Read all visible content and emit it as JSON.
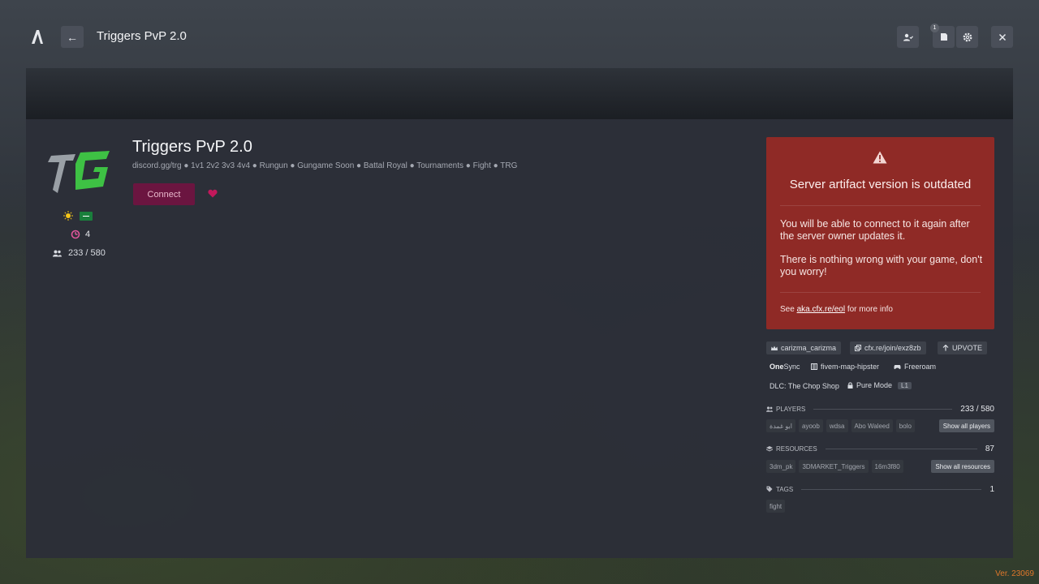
{
  "header": {
    "title": "Triggers PvP 2.0",
    "back_icon": "←",
    "notif_count": "1"
  },
  "server": {
    "name": "Triggers PvP 2.0",
    "description": "discord.gg/trg ● 1v1 2v2 3v3 4v4 ● Rungun ● Gungame Soon ● Battal Royal ● Tournaments ● Fight ● TRG",
    "connect_label": "Connect",
    "boost_count": "4",
    "players_short": "233 / 580"
  },
  "warning": {
    "title": "Server artifact version is outdated",
    "body1": "You will be able to connect to it again after the server owner updates it.",
    "body2": "There is nothing wrong with your game, don't you worry!",
    "see": "See",
    "link": "aka.cfx.re/eol",
    "more": "for more info"
  },
  "info": {
    "owner": "carizma_carizma",
    "join_link": "cfx.re/join/exz8zb",
    "upvote": "UPVOTE",
    "onesync_a": "One",
    "onesync_b": "Sync",
    "map": "fivem-map-hipster",
    "gametype": "Freeroam",
    "dlc": "DLC: The Chop Shop",
    "pure_mode": "Pure Mode",
    "pure_level": "L1"
  },
  "players": {
    "label": "PLAYERS",
    "count": "233 / 580",
    "names": [
      "ابو غمدة",
      "ayoob",
      "wdsa",
      "Abo Waleed",
      "bolo"
    ],
    "show_all": "Show all players"
  },
  "resources": {
    "label": "RESOURCES",
    "count": "87",
    "names": [
      "3dm_pk",
      "3DMARKET_Triggers",
      "16m3f80"
    ],
    "show_all": "Show all resources"
  },
  "tags": {
    "label": "TAGS",
    "count": "1",
    "names": [
      "fight"
    ]
  },
  "footer": {
    "version": "Ver. 23069"
  },
  "colors": {
    "accent": "#6b1540",
    "warning_bg": "#8f2a26",
    "version": "#e0772a",
    "heart": "#c2185b"
  }
}
